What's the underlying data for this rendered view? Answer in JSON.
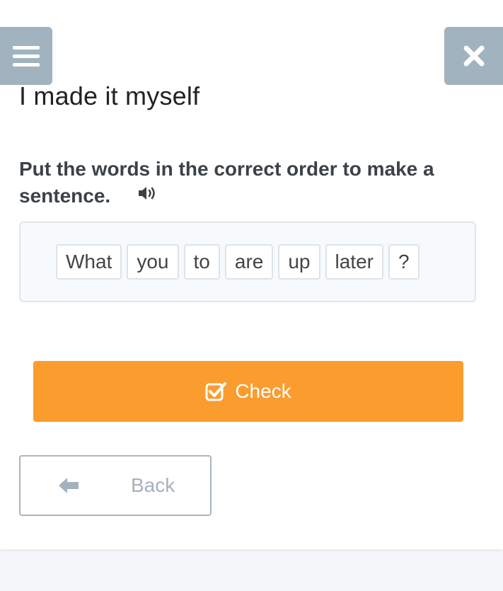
{
  "header": {
    "menu_icon": "hamburger-menu-icon",
    "close_icon": "close-x-icon"
  },
  "lesson": {
    "title": "I made it myself"
  },
  "exercise": {
    "instruction": "Put the words in the correct order to make a sentence.",
    "audio_icon": "speaker-icon",
    "words": [
      "What",
      "you",
      "to",
      "are",
      "up",
      "later",
      "?"
    ]
  },
  "actions": {
    "check_label": "Check",
    "check_icon": "checkbox-icon",
    "back_label": "Back",
    "back_icon": "arrow-left-icon"
  },
  "colors": {
    "accent": "#fb9c2e",
    "control_gray": "#a1b3bf"
  }
}
